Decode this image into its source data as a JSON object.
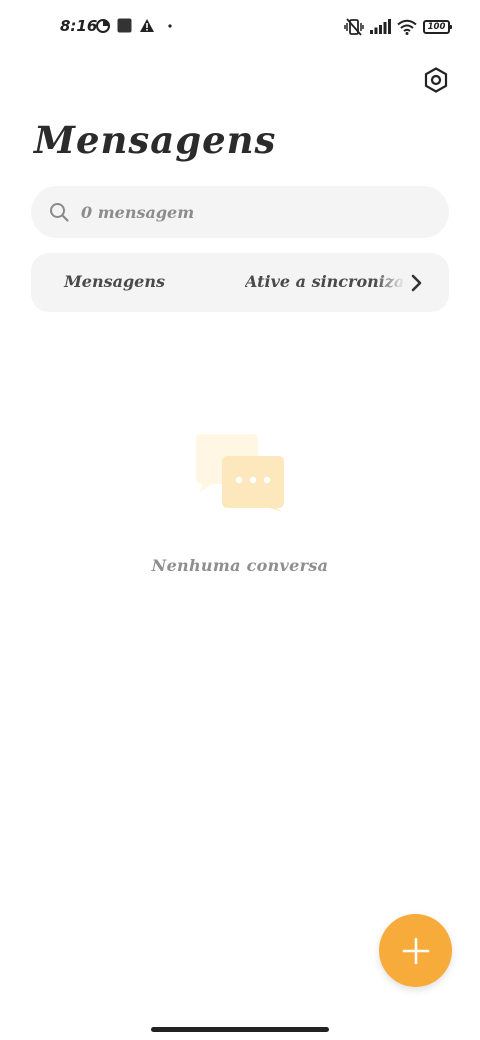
{
  "status_bar": {
    "time": "8:16",
    "battery": "100",
    "left_icons": [
      "data-saver-icon",
      "app-square-icon",
      "warning-icon",
      "dot-icon"
    ],
    "right_icons": [
      "vibrate-off-icon",
      "signal-icon",
      "wifi-icon",
      "battery-icon"
    ]
  },
  "header": {
    "title": "Mensagens",
    "settings_icon": "settings-hex-icon"
  },
  "search": {
    "placeholder": "0 mensagem",
    "icon": "search-icon"
  },
  "sync_banner": {
    "left_text": "Mensagens",
    "right_text": "Ative a sincronização",
    "icon": "chevron-right-icon"
  },
  "empty_state": {
    "icon": "chat-bubbles-icon",
    "text": "Nenhuma conversa"
  },
  "fab": {
    "icon": "plus-icon"
  },
  "colors": {
    "accent": "#f7ab3a",
    "surface": "#f4f4f4",
    "title": "#2b2b2b",
    "muted": "#8f8f8f",
    "illustration_back": "#fff6e3",
    "illustration_front": "#fde8bd"
  }
}
